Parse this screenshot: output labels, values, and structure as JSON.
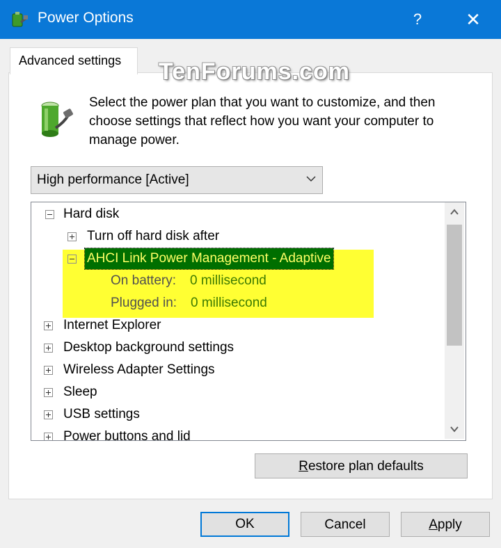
{
  "window": {
    "title": "Power Options",
    "help_glyph": "?",
    "close_glyph": "✕",
    "icon": "power-options-icon"
  },
  "tab": {
    "label": "Advanced settings"
  },
  "watermark": "TenForums.com",
  "intro": {
    "text": "Select the power plan that you want to customize, and then choose settings that reflect how you want your computer to manage power.",
    "icon": "battery-plug-icon"
  },
  "plan_select": {
    "value": "High performance [Active]"
  },
  "tree": {
    "hard_disk": {
      "label": "Hard disk",
      "expanded": true
    },
    "turn_off": {
      "label": "Turn off hard disk after",
      "expanded": false
    },
    "ahci": {
      "label": "AHCI Link Power Management - Adaptive",
      "expanded": true,
      "selected": true
    },
    "on_battery": {
      "label": "On battery:",
      "value": "0 millisecond"
    },
    "plugged_in": {
      "label": "Plugged in:",
      "value": "0 millisecond"
    },
    "internet_explorer": {
      "label": "Internet Explorer"
    },
    "desktop_background": {
      "label": "Desktop background settings"
    },
    "wireless_adapter": {
      "label": "Wireless Adapter Settings"
    },
    "sleep": {
      "label": "Sleep"
    },
    "usb": {
      "label": "USB settings"
    },
    "power_buttons": {
      "label": "Power buttons and lid"
    },
    "highlight_color": "#ffff33"
  },
  "buttons": {
    "restore": {
      "mnemonic": "R",
      "rest": "estore plan defaults"
    },
    "ok": {
      "label": "OK"
    },
    "cancel": {
      "label": "Cancel"
    },
    "apply": {
      "mnemonic": "A",
      "rest": "pply"
    }
  },
  "colors": {
    "titlebar": "#0a78d7",
    "selection_bg": "#006f00",
    "selection_text": "#ffff66",
    "highlight": "#ffff33"
  }
}
